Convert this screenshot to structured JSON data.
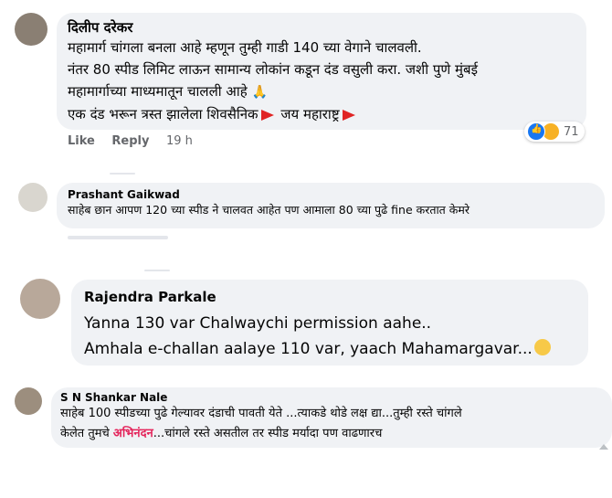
{
  "comments": [
    {
      "author": "दिलीप दरेकर",
      "lines": [
        "महामार्ग चांगला बनला आहे म्हणून तुम्ही गाडी 140 च्या वेगाने चालवली.",
        "नंतर 80 स्पीड लिमिट लाऊन सामान्य लोकांन कडून दंड वसुली करा. जशी पुणे मुंबई",
        "महामार्गाच्या माध्यमातून चालली आहे",
        "एक दंड भरून त्रस्त झालेला शिवसैनिक",
        "जय महाराष्ट्र"
      ],
      "actions": {
        "like": "Like",
        "reply": "Reply",
        "time": "19 h"
      },
      "reaction_count": "71",
      "reaction_icons": [
        "like-icon",
        "haha-icon"
      ],
      "flag_color": "#e02424"
    },
    {
      "author": "Prashant Gaikwad",
      "lines": [
        "साहेब छान आपण 120 च्या स्पीड ने चालवत आहेत पण आमाला 80 च्या पुढे fine करतात केमरे"
      ]
    },
    {
      "author": "Rajendra Parkale",
      "lines": [
        "Yanna 130 var Chalwaychi permission aahe..",
        "Amhala e-challan aalaye 110 var, yaach Mahamargavar..."
      ]
    },
    {
      "author": "S N Shankar Nale",
      "lines": [
        "साहेब 100 स्पीडच्या पुढे गेल्यावर दंडाची पावती येते ...त्याकडे थोडे लक्ष द्या...तुम्ही रस्ते चांगले",
        "केलेत तुमचे ",
        "अभिनंदन",
        "...चांगले रस्ते असतील तर स्पीड मर्यादा पण वाढणारच"
      ],
      "highlight_color": "#e4245b"
    }
  ]
}
